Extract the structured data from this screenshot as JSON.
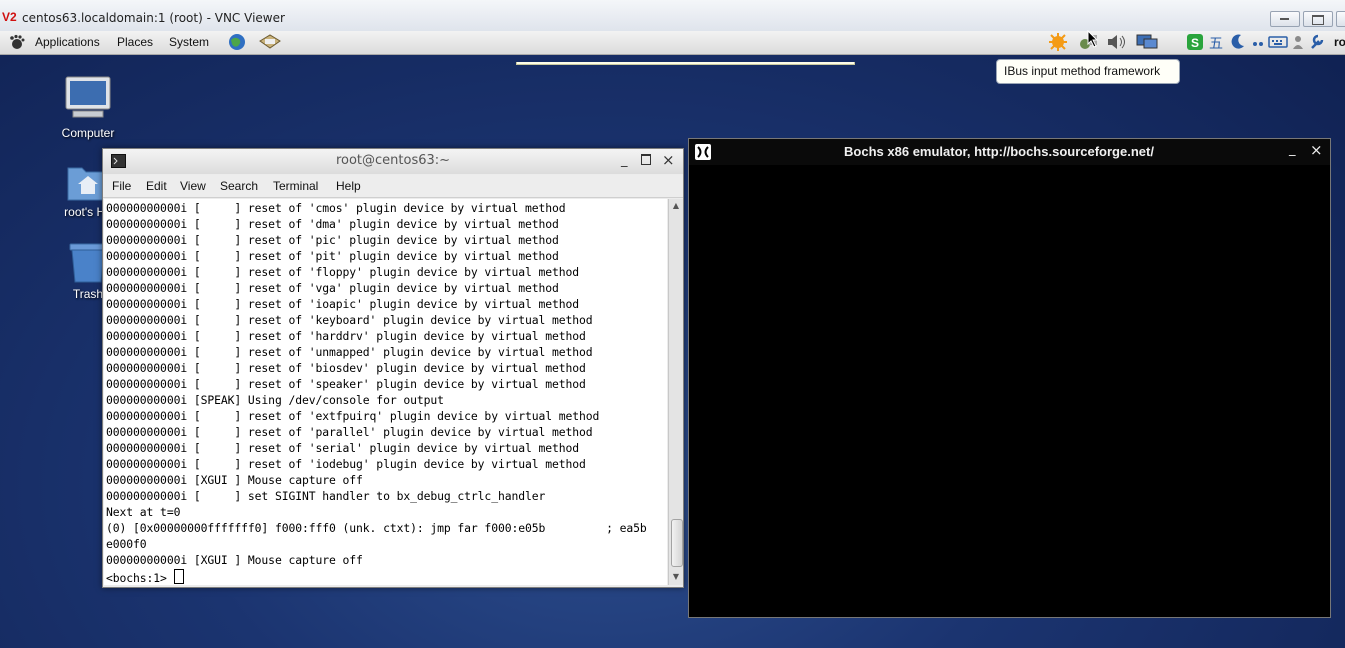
{
  "vnc": {
    "logo": "V2",
    "title": "centos63.localdomain:1 (root) - VNC Viewer"
  },
  "panel": {
    "applications": "Applications",
    "places": "Places",
    "system": "System",
    "user_partial": "ro",
    "tooltip": "IBus input method framework",
    "ime_wubi": "五"
  },
  "desktop": {
    "icons": [
      {
        "label": "Computer"
      },
      {
        "label": "root's Ho"
      },
      {
        "label": "Trash"
      }
    ]
  },
  "terminal": {
    "title": "root@centos63:~",
    "menu": [
      "File",
      "Edit",
      "View",
      "Search",
      "Terminal",
      "Help"
    ],
    "lines": [
      "00000000000i [     ] reset of 'cmos' plugin device by virtual method",
      "00000000000i [     ] reset of 'dma' plugin device by virtual method",
      "00000000000i [     ] reset of 'pic' plugin device by virtual method",
      "00000000000i [     ] reset of 'pit' plugin device by virtual method",
      "00000000000i [     ] reset of 'floppy' plugin device by virtual method",
      "00000000000i [     ] reset of 'vga' plugin device by virtual method",
      "00000000000i [     ] reset of 'ioapic' plugin device by virtual method",
      "00000000000i [     ] reset of 'keyboard' plugin device by virtual method",
      "00000000000i [     ] reset of 'harddrv' plugin device by virtual method",
      "00000000000i [     ] reset of 'unmapped' plugin device by virtual method",
      "00000000000i [     ] reset of 'biosdev' plugin device by virtual method",
      "00000000000i [     ] reset of 'speaker' plugin device by virtual method",
      "00000000000i [SPEAK] Using /dev/console for output",
      "00000000000i [     ] reset of 'extfpuirq' plugin device by virtual method",
      "00000000000i [     ] reset of 'parallel' plugin device by virtual method",
      "00000000000i [     ] reset of 'serial' plugin device by virtual method",
      "00000000000i [     ] reset of 'iodebug' plugin device by virtual method",
      "00000000000i [XGUI ] Mouse capture off",
      "00000000000i [     ] set SIGINT handler to bx_debug_ctrlc_handler",
      "Next at t=0",
      "(0) [0x00000000fffffff0] f000:fff0 (unk. ctxt): jmp far f000:e05b         ; ea5b",
      "e000f0",
      "00000000000i [XGUI ] Mouse capture off"
    ],
    "prompt": "<bochs:1> "
  },
  "bochs": {
    "title": "Bochs x86 emulator, http://bochs.sourceforge.net/"
  }
}
